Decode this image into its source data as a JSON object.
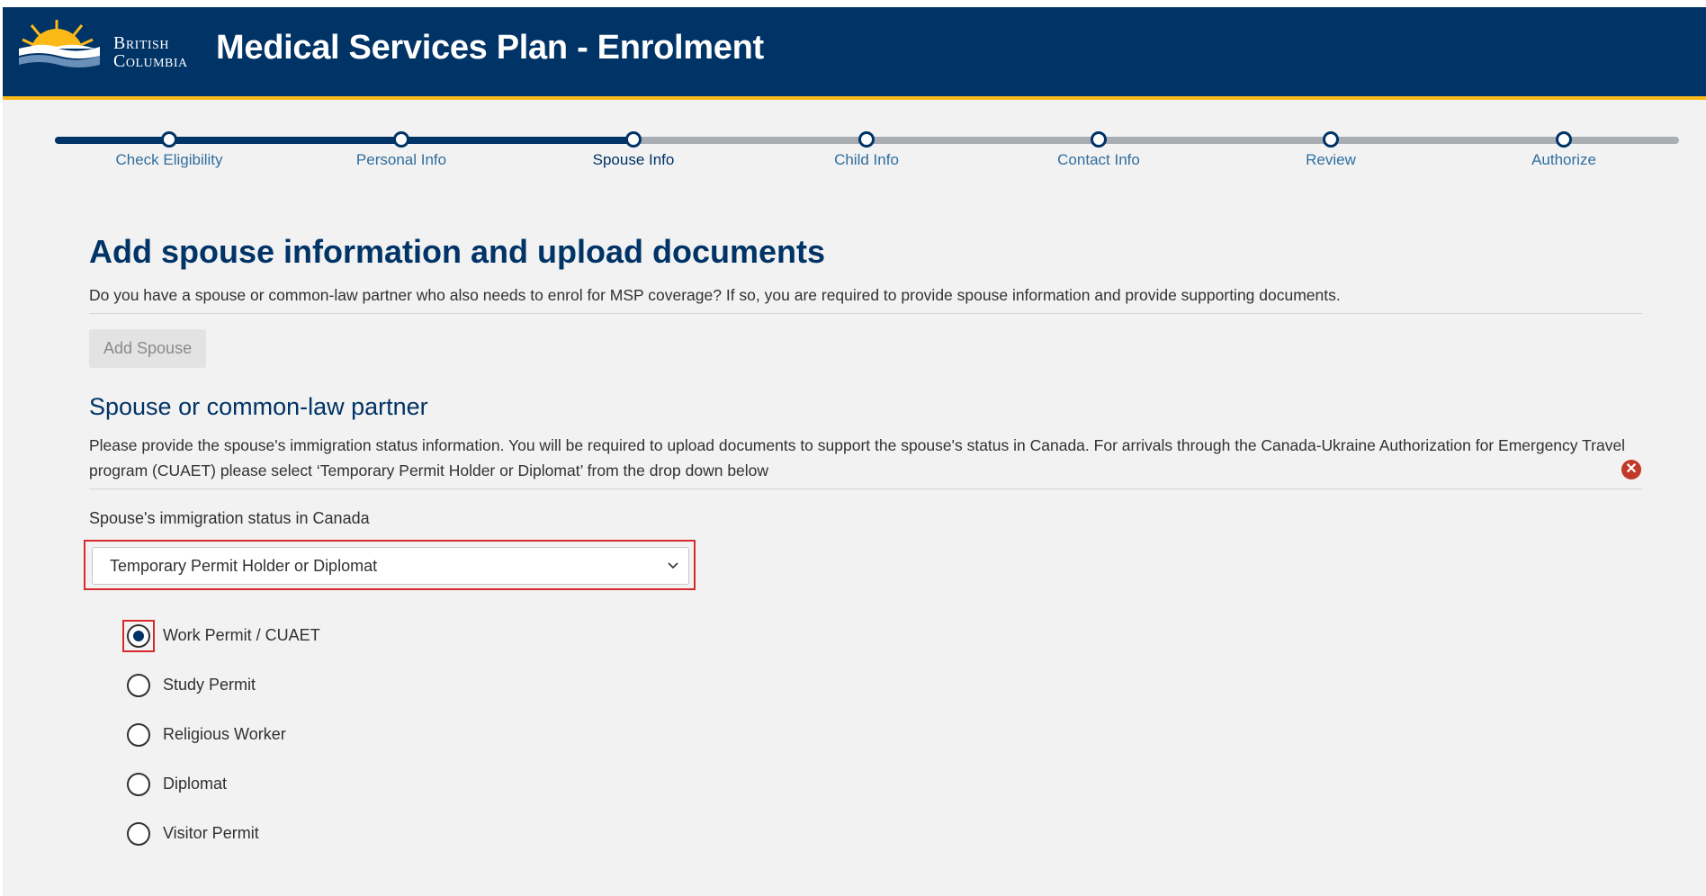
{
  "header": {
    "logo_text_line1": "British",
    "logo_text_line2": "Columbia",
    "title": "Medical Services Plan - Enrolment",
    "colors": {
      "background": "#003366",
      "accent": "#fcba19"
    }
  },
  "progress": {
    "steps": [
      {
        "label": "Check Eligibility",
        "state": "complete"
      },
      {
        "label": "Personal Info",
        "state": "complete"
      },
      {
        "label": "Spouse Info",
        "state": "active"
      },
      {
        "label": "Child Info",
        "state": "pending"
      },
      {
        "label": "Contact Info",
        "state": "pending"
      },
      {
        "label": "Review",
        "state": "pending"
      },
      {
        "label": "Authorize",
        "state": "pending"
      }
    ]
  },
  "main": {
    "heading": "Add spouse information and upload documents",
    "intro": "Do you have a spouse or common-law partner who also needs to enrol for MSP coverage? If so, you are required to provide spouse information and provide supporting documents.",
    "add_spouse_label": "Add Spouse",
    "section_heading": "Spouse or common-law partner",
    "section_desc": "Please provide the spouse's immigration status information. You will be required to upload documents to support the spouse's status in Canada. For arrivals through the Canada-Ukraine Authorization for Emergency Travel program (CUAET) please select ‘Temporary Permit Holder or Diplomat’ from the drop down below",
    "status_label": "Spouse's immigration status in Canada",
    "status_value": "Temporary Permit Holder or Diplomat",
    "permit_options": [
      {
        "label": "Work Permit / CUAET",
        "checked": true
      },
      {
        "label": "Study Permit",
        "checked": false
      },
      {
        "label": "Religious Worker",
        "checked": false
      },
      {
        "label": "Diplomat",
        "checked": false
      },
      {
        "label": "Visitor Permit",
        "checked": false
      }
    ],
    "colors": {
      "heading": "#003366",
      "error": "#d8292f"
    }
  }
}
